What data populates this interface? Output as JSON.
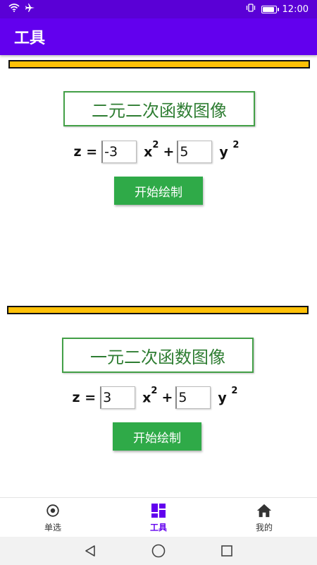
{
  "status_bar": {
    "time": "12:00",
    "icons": [
      "wifi-icon",
      "airplane-icon",
      "vibrate-icon",
      "battery-icon"
    ]
  },
  "app_bar": {
    "title": "工具"
  },
  "sections": [
    {
      "title": "二元二次函数图像",
      "formula": {
        "lhs": "z =",
        "coef_x": "-3",
        "x_term": "x",
        "x_exp": "2",
        "plus": "+",
        "coef_y": "5",
        "y_term": "y",
        "y_exp": "2"
      },
      "button_label": "开始绘制"
    },
    {
      "title": "一元二次函数图像",
      "formula": {
        "lhs": "z =",
        "coef_x": "3",
        "x_term": "x",
        "x_exp": "2",
        "plus": "+",
        "coef_y": "5",
        "y_term": "y",
        "y_exp": "2"
      },
      "button_label": "开始绘制"
    }
  ],
  "bottom_nav": {
    "items": [
      {
        "label": "单选",
        "icon": "eye-icon",
        "active": false
      },
      {
        "label": "工具",
        "icon": "dashboard-icon",
        "active": true
      },
      {
        "label": "我的",
        "icon": "home-icon",
        "active": false
      }
    ]
  },
  "system_nav": [
    "back-icon",
    "home-circle-icon",
    "recents-icon"
  ],
  "colors": {
    "app_bar": "#6200ee",
    "status_bar": "#5a00d6",
    "divider": "#ffc107",
    "title_border": "#43a047",
    "button": "#2faa48",
    "nav_active": "#6200ee"
  }
}
